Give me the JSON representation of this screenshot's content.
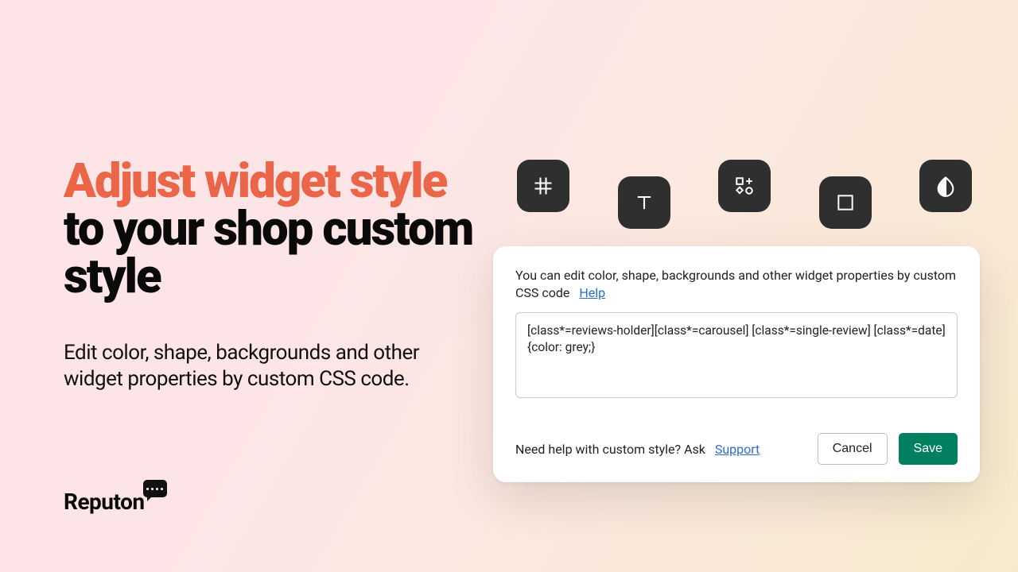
{
  "headline": {
    "accent": "Adjust widget style",
    "rest": " to your shop custom style"
  },
  "subhead": "Edit color, shape, backgrounds and other widget properties by custom CSS code.",
  "logo": {
    "text": "Reputon"
  },
  "toolbar": {
    "items": [
      {
        "name": "grid-icon"
      },
      {
        "name": "text-icon"
      },
      {
        "name": "shapes-icon"
      },
      {
        "name": "square-icon"
      },
      {
        "name": "contrast-icon"
      }
    ]
  },
  "card": {
    "description": "You can edit color, shape, backgrounds and other widget properties by custom CSS code",
    "help_label": "Help",
    "code_value": "[class*=reviews-holder][class*=carousel] [class*=single-review] [class*=date] {color: grey;}",
    "footer_text": "Need help with custom style? Ask",
    "support_label": "Support",
    "cancel_label": "Cancel",
    "save_label": "Save"
  }
}
